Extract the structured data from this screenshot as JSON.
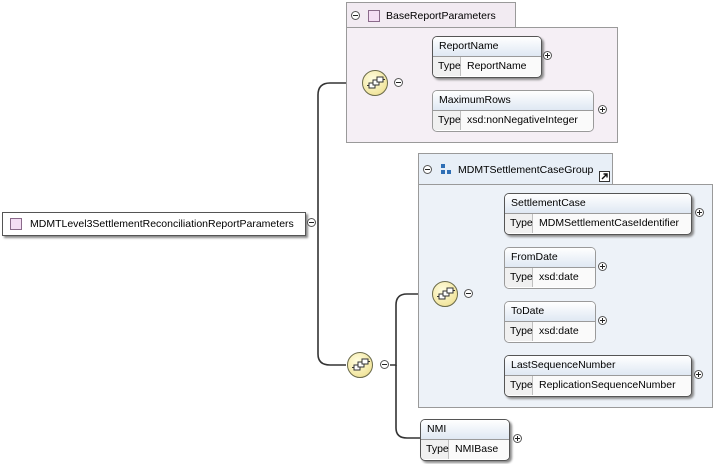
{
  "root": {
    "label": "MDMTLevel3SettlementReconciliationReportParameters"
  },
  "attribute_group": {
    "label": "BaseReportParameters"
  },
  "element_group": {
    "label": "MDMTSettlementCaseGroup"
  },
  "type_label": "Type",
  "elements": [
    {
      "name": "ReportName",
      "type": "ReportName",
      "optional": false
    },
    {
      "name": "MaximumRows",
      "type": "xsd:nonNegativeInteger",
      "optional": true
    },
    {
      "name": "SettlementCase",
      "type": "MDMSettlementCaseIdentifier",
      "optional": false
    },
    {
      "name": "FromDate",
      "type": "xsd:date",
      "optional": true
    },
    {
      "name": "ToDate",
      "type": "xsd:date",
      "optional": true
    },
    {
      "name": "LastSequenceNumber",
      "type": "ReplicationSequenceNumber",
      "optional": false
    },
    {
      "name": "NMI",
      "type": "NMIBase",
      "optional": false
    }
  ],
  "colors": {
    "attribute_group_fill": "#f5eff5",
    "element_group_fill": "#edf2f8",
    "sequence_fill": "#f2e6a0",
    "element_header": "#dfe8f3"
  },
  "icons": [
    "collapse-icon",
    "expand-icon",
    "sequence-compositor-icon",
    "attribute-group-icon",
    "element-group-icon",
    "reference-arrow-icon"
  ]
}
